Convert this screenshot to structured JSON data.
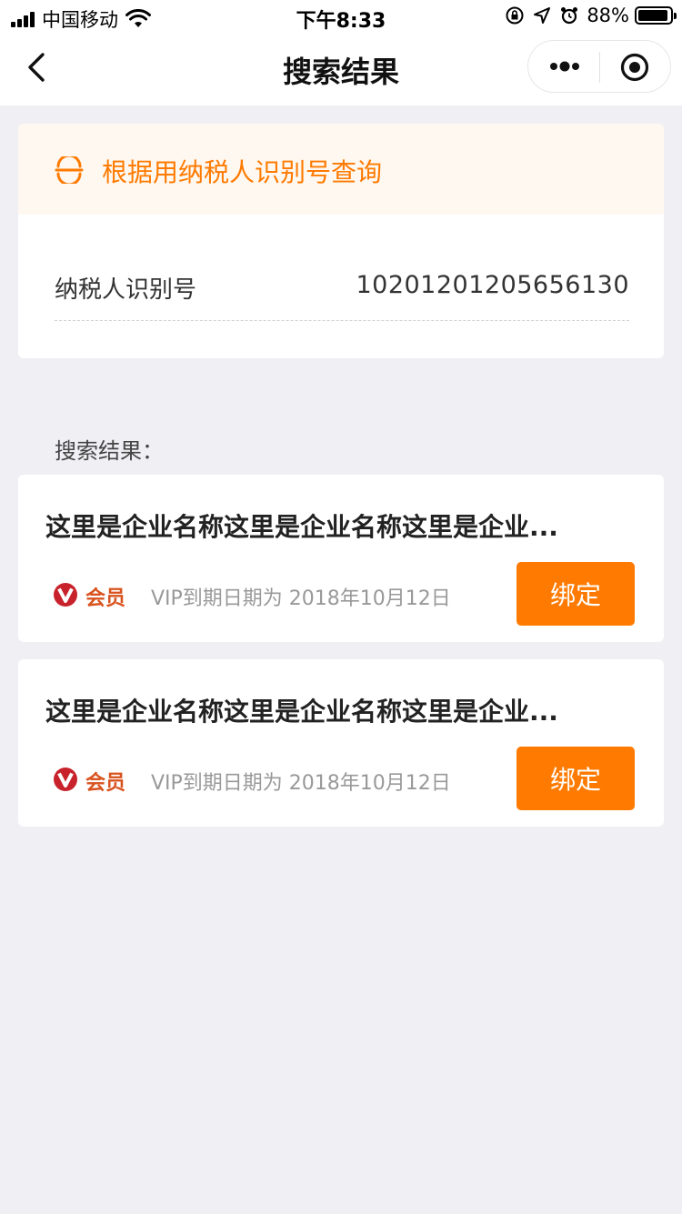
{
  "status_bar": {
    "carrier": "中国移动",
    "time": "下午8:33",
    "battery": "88%"
  },
  "nav": {
    "title": "搜索结果",
    "back_icon": "chevron-left-icon",
    "more_icon": "more-dots-icon",
    "close_icon": "target-circle-icon"
  },
  "query": {
    "heading": "根据用纳税人识别号查询",
    "field_label": "纳税人识别号",
    "field_value": "10201201205656130"
  },
  "results": {
    "label": "搜索结果：",
    "items": [
      {
        "company": "这里是企业名称这里是企业名称这里是企业...",
        "member": "会员",
        "expiry": "VIP到期日期为 2018年10月12日",
        "button": "绑定"
      },
      {
        "company": "这里是企业名称这里是企业名称这里是企业...",
        "member": "会员",
        "expiry": "VIP到期日期为 2018年10月12日",
        "button": "绑定"
      }
    ]
  },
  "colors": {
    "accent": "#ff7a00",
    "badge_red": "#c8232c",
    "background": "#efeff4"
  }
}
